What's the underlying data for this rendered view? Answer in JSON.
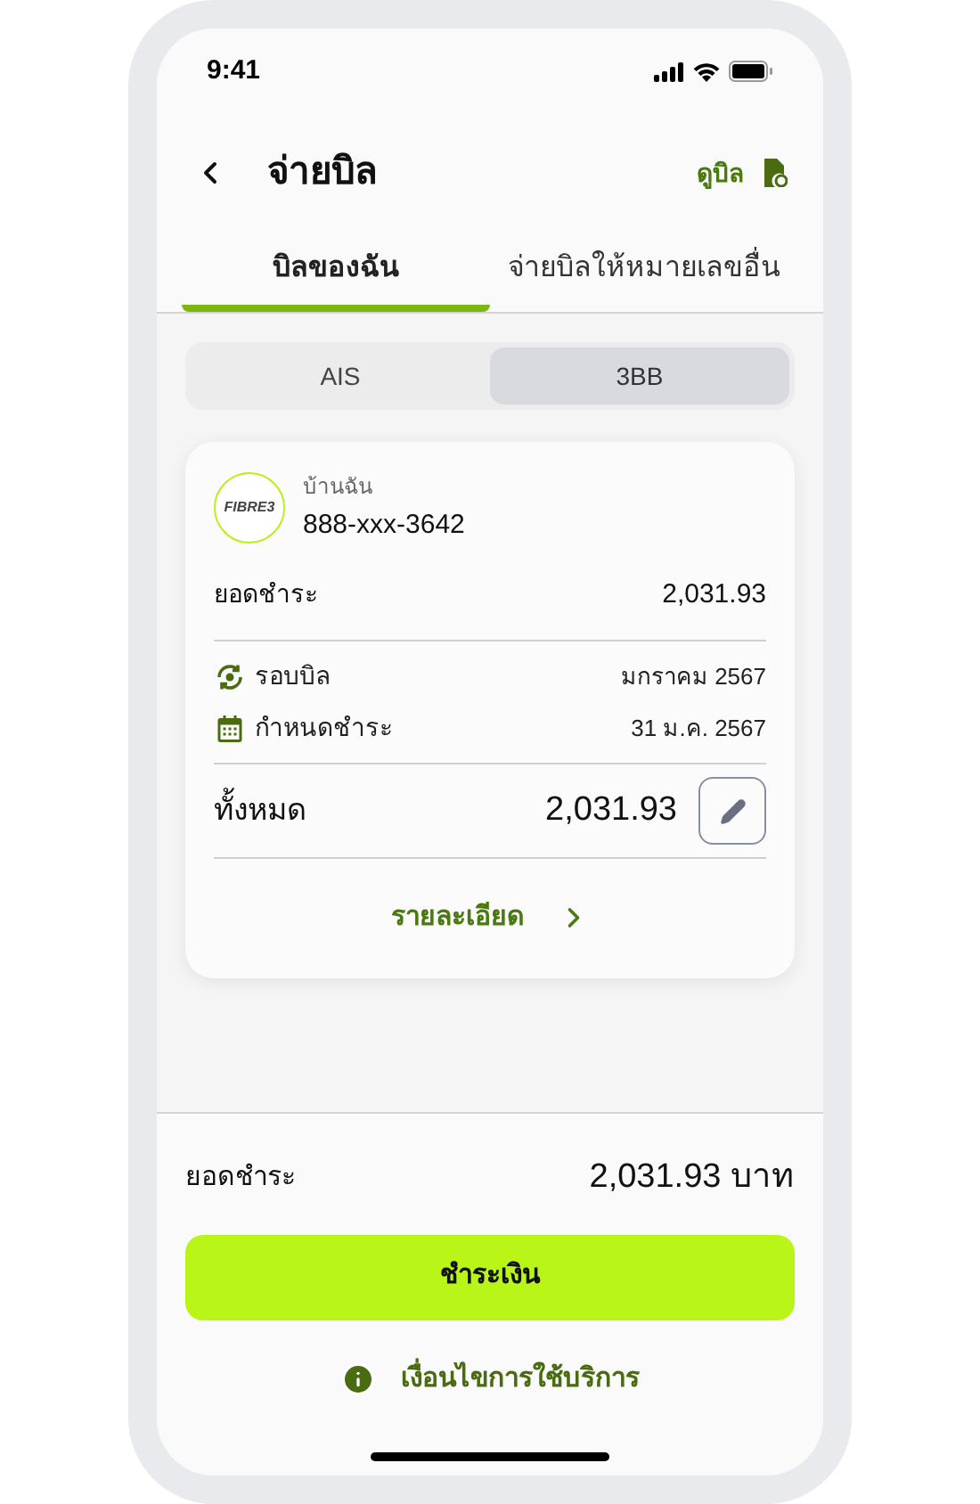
{
  "status_bar": {
    "time": "9:41"
  },
  "header": {
    "title": "จ่ายบิล",
    "action": "ดูบิล"
  },
  "tabs": [
    {
      "label": "บิลของฉัน",
      "selected": true
    },
    {
      "label": "จ่ายบิลให้หมายเลขอื่น",
      "selected": false
    }
  ],
  "segments": [
    {
      "label": "AIS",
      "selected": false
    },
    {
      "label": "3BB",
      "selected": true
    }
  ],
  "bill": {
    "logo_text": "FIBRE3",
    "name": "บ้านฉัน",
    "number": "888-xxx-3642",
    "due_label": "ยอดชำระ",
    "due_amount": "2,031.93",
    "details": [
      {
        "kind": "cycle",
        "label": "รอบบิล",
        "value": "มกราคม 2567"
      },
      {
        "kind": "deadline",
        "label": "กำหนดชำระ",
        "value": "31 ม.ค. 2567"
      }
    ],
    "total_label": "ทั้งหมด",
    "total_amount": "2,031.93",
    "more": "รายละเอียด"
  },
  "summary": {
    "label": "ยอดชำระ",
    "amount": "2,031.93 บาท"
  },
  "pay_button": "ชำระเงิน",
  "terms_link": "เงื่อนไขการใช้บริการ"
}
